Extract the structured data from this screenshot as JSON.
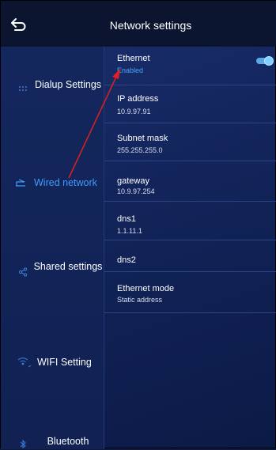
{
  "header": {
    "title": "Network settings",
    "back_icon": "back-arrow-icon"
  },
  "sidebar": {
    "items": [
      {
        "label": "Dialup Settings",
        "icon": "dialpad-icon",
        "active": false
      },
      {
        "label": "Wired network",
        "icon": "ethernet-icon",
        "active": true
      },
      {
        "label": "Shared settings",
        "icon": "share-icon",
        "active": false
      },
      {
        "label": "WIFI Setting",
        "icon": "wifi-icon",
        "active": false
      },
      {
        "label": "Bluetooth",
        "icon": "bluetooth-icon",
        "active": false
      }
    ]
  },
  "settings": {
    "ethernet": {
      "title": "Ethernet",
      "value": "Enabled",
      "toggle_on": true
    },
    "ip_address": {
      "title": "IP address",
      "value": "10.9.97.91"
    },
    "subnet_mask": {
      "title": "Subnet mask",
      "value": "255.255.255.0"
    },
    "gateway": {
      "title": "gateway",
      "value": "10.9.97.254"
    },
    "dns1": {
      "title": "dns1",
      "value": "1.1.11.1"
    },
    "dns2": {
      "title": "dns2",
      "value": ""
    },
    "ethernet_mode": {
      "title": "Ethernet mode",
      "value": "Static address"
    }
  },
  "colors": {
    "accent": "#3f9bff",
    "annotation_arrow": "#e02020",
    "background": "#13265c"
  }
}
